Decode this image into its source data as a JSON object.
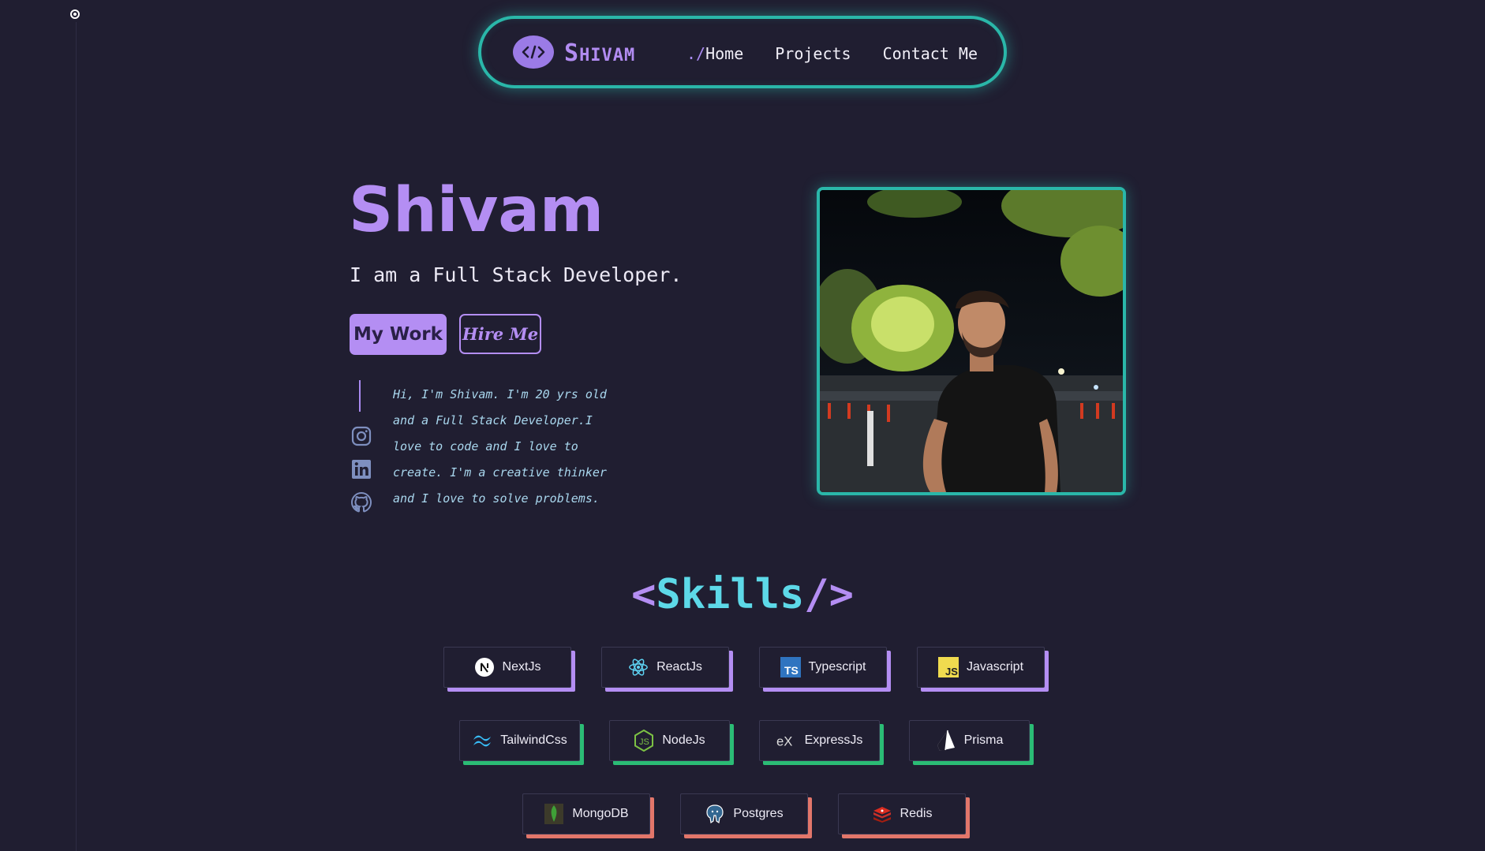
{
  "page": {
    "colors": {
      "background": "#201e31",
      "accent_purple": "#b48ef3",
      "accent_teal": "#2ab7a9",
      "skills_cyan": "#5dd9e8",
      "frontend_shadow": "#b48ef3",
      "backend_shadow": "#2bbc75",
      "database_shadow": "#e2766a"
    }
  },
  "navbar": {
    "logo_icon": "code-brackets-icon",
    "brand_first": "S",
    "brand_rest": "HIVAM",
    "links": [
      {
        "prefix": "./",
        "label": "Home"
      },
      {
        "prefix": "",
        "label": "Projects"
      },
      {
        "prefix": "",
        "label": "Contact Me"
      }
    ]
  },
  "hero": {
    "name": "Shivam",
    "role": "I am a Full Stack Developer.",
    "primary_button": "My Work",
    "secondary_button": "Hire Me",
    "bio": "Hi, I'm Shivam. I'm 20 yrs old\nand a Full Stack Developer.I\nlove to code and I love to\ncreate. I'm a creative thinker\nand I love to solve problems.",
    "socials": [
      "instagram-icon",
      "linkedin-icon",
      "github-icon"
    ]
  },
  "skills": {
    "open": "<",
    "word": "Skills",
    "close": "/>",
    "rows": [
      [
        {
          "label": "NextJs",
          "icon": "nextjs-icon"
        },
        {
          "label": "ReactJs",
          "icon": "react-icon"
        },
        {
          "label": "Typescript",
          "icon": "typescript-icon"
        },
        {
          "label": "Javascript",
          "icon": "javascript-icon"
        }
      ],
      [
        {
          "label": "TailwindCss",
          "icon": "tailwind-icon"
        },
        {
          "label": "NodeJs",
          "icon": "nodejs-icon"
        },
        {
          "label": "ExpressJs",
          "icon": "express-icon"
        },
        {
          "label": "Prisma",
          "icon": "prisma-icon"
        }
      ],
      [
        {
          "label": "MongoDB",
          "icon": "mongodb-icon"
        },
        {
          "label": "Postgres",
          "icon": "postgres-icon"
        },
        {
          "label": "Redis",
          "icon": "redis-icon"
        }
      ]
    ]
  }
}
